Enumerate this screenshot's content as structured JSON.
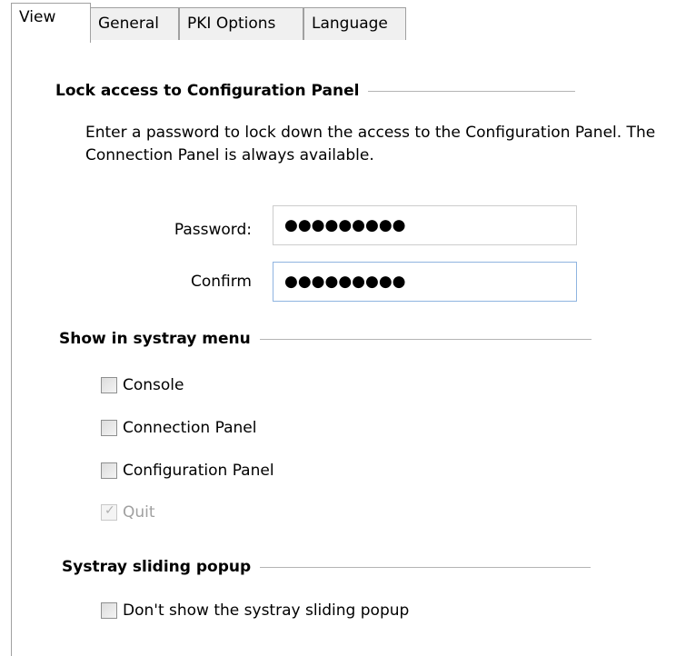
{
  "tabs": [
    {
      "label": "View",
      "active": true
    },
    {
      "label": "General",
      "active": false
    },
    {
      "label": "PKI Options",
      "active": false
    },
    {
      "label": "Language",
      "active": false
    }
  ],
  "lock_section": {
    "title": "Lock access to Configuration Panel",
    "description": "Enter a password to lock down the access to the Configuration Panel. The Connection Panel is always available.",
    "password_label": "Password:",
    "password_value": "●●●●●●●●●",
    "confirm_label": "Confirm",
    "confirm_value": "●●●●●●●●●"
  },
  "systray_section": {
    "title": "Show in systray menu",
    "items": [
      {
        "label": "Console",
        "checked": false,
        "enabled": true
      },
      {
        "label": "Connection Panel",
        "checked": false,
        "enabled": true
      },
      {
        "label": "Configuration Panel",
        "checked": false,
        "enabled": true
      },
      {
        "label": "Quit",
        "checked": true,
        "enabled": false
      }
    ]
  },
  "popup_section": {
    "title": "Systray sliding popup",
    "items": [
      {
        "label": "Don't show the systray sliding popup",
        "checked": false,
        "enabled": true
      }
    ]
  },
  "colors": {
    "border": "#a0a0a0",
    "focus_border": "#8fb4e0",
    "disabled_text": "#a0a0a0"
  }
}
